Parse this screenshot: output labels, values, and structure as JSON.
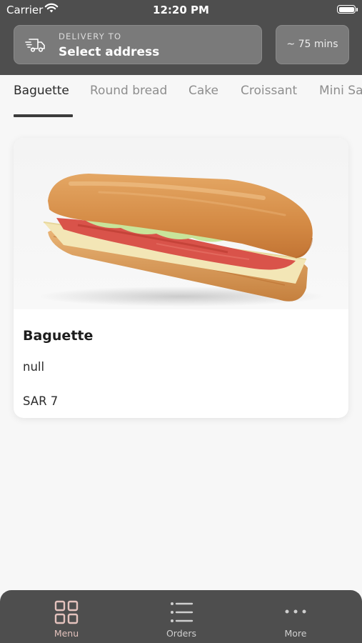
{
  "status_bar": {
    "carrier": "Carrier",
    "time": "12:20 PM"
  },
  "header": {
    "delivery_label": "DELIVERY TO",
    "delivery_value": "Select address",
    "eta": "~ 75 mins"
  },
  "tabs": [
    {
      "label": "Baguette",
      "active": true
    },
    {
      "label": "Round bread"
    },
    {
      "label": "Cake"
    },
    {
      "label": "Croissant"
    },
    {
      "label": "Mini Sa"
    }
  ],
  "product": {
    "name": "Baguette",
    "description": "null",
    "price": "SAR 7",
    "image": "baguette-sandwich-photo"
  },
  "bottom_nav": [
    {
      "label": "Menu",
      "icon": "grid-icon",
      "active": true
    },
    {
      "label": "Orders",
      "icon": "list-icon"
    },
    {
      "label": "More",
      "icon": "more-dots-icon"
    }
  ],
  "colors": {
    "header_bg": "#4e4e4e",
    "active_tab": "#2a2a2a",
    "inactive_tab": "#8e8e8e",
    "nav_active": "#e4c2bd"
  }
}
